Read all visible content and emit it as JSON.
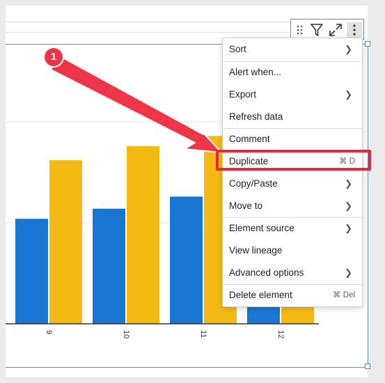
{
  "toolbar": {
    "icons": [
      "drag-handle-icon",
      "filter-icon",
      "expand-icon",
      "more-vertical-icon"
    ]
  },
  "chart_data": {
    "type": "bar",
    "categories": [
      "9",
      "10",
      "11",
      "12"
    ],
    "series": [
      {
        "color": "#1976d2",
        "values": [
          52,
          57,
          63,
          null
        ]
      },
      {
        "color": "#f5b914",
        "values": [
          81,
          88,
          93,
          null
        ]
      }
    ],
    "ylim": [
      0,
      150
    ],
    "grid": true
  },
  "menu": {
    "items": [
      {
        "label": "Sort",
        "submenu": true
      },
      {
        "label": "Alert when...",
        "submenu": false
      },
      {
        "label": "Export",
        "submenu": true
      },
      {
        "label": "Refresh data",
        "submenu": false
      },
      {
        "label": "Comment",
        "submenu": false
      },
      {
        "label": "Duplicate",
        "shortcut": "⌘ D"
      },
      {
        "label": "Copy/Paste",
        "submenu": true
      },
      {
        "label": "Move to",
        "submenu": true
      },
      {
        "label": "Element source",
        "submenu": true
      },
      {
        "label": "View lineage",
        "submenu": false
      },
      {
        "label": "Advanced options",
        "submenu": true
      },
      {
        "label": "Delete element",
        "shortcut": "⌘ Del"
      }
    ]
  },
  "annotation": {
    "step_number": "1",
    "color": "#ef3649"
  }
}
